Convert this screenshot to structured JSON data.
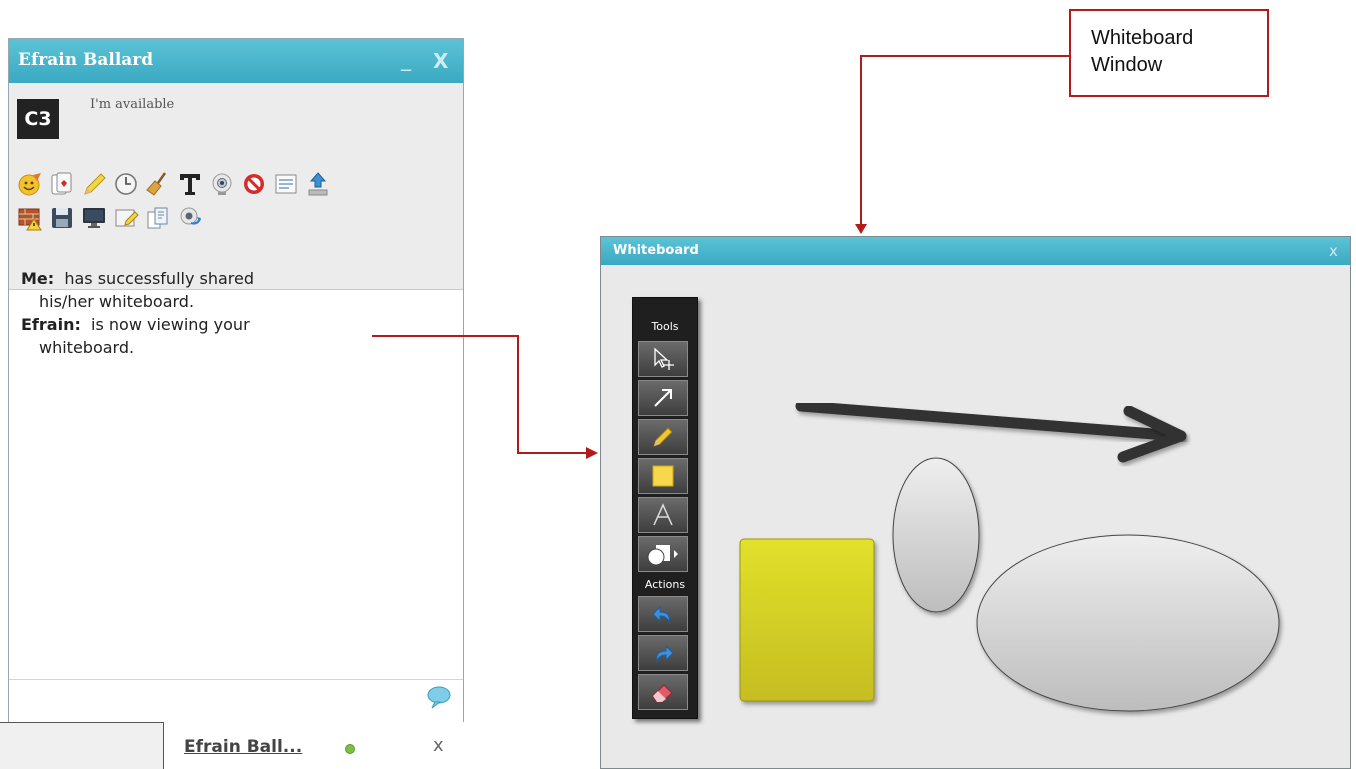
{
  "chat": {
    "title": "Efrain Ballard",
    "minimize_glyph": "_",
    "close_glyph": "X",
    "avatar_text": "C3",
    "status": "I'm available",
    "toolbar_icons": [
      "emoticon-icon",
      "game-cards-icon",
      "pencil-icon",
      "clock-icon",
      "broom-icon",
      "text-icon",
      "webcam-icon",
      "block-icon",
      "text-list-icon",
      "upload-icon",
      "firewall-warning-icon",
      "save-icon",
      "monitor-icon",
      "whiteboard-edit-icon",
      "documents-icon",
      "webcam-share-icon"
    ],
    "messages": [
      {
        "sender": "Me:",
        "text": "has successfully shared",
        "cont": "his/her whiteboard."
      },
      {
        "sender": "Efrain:",
        "text": "is now viewing your",
        "cont": "whiteboard."
      }
    ]
  },
  "tabbar": {
    "tab_label": "Efrain Ball...",
    "close_glyph": "x",
    "status_color": "#7ac142"
  },
  "annotation": {
    "label_line1": "Whiteboard",
    "label_line2": "Window",
    "color": "#b31b1b"
  },
  "whiteboard": {
    "title": "Whiteboard",
    "close_glyph": "x",
    "toolbar": {
      "tools_label": "Tools",
      "actions_label": "Actions",
      "tools": [
        "select-move-icon",
        "arrow-tool-icon",
        "pencil-tool-icon",
        "note-tool-icon",
        "text-tool-icon",
        "shapes-tool-icon"
      ],
      "actions": [
        "undo-icon",
        "redo-icon",
        "eraser-icon"
      ]
    }
  }
}
